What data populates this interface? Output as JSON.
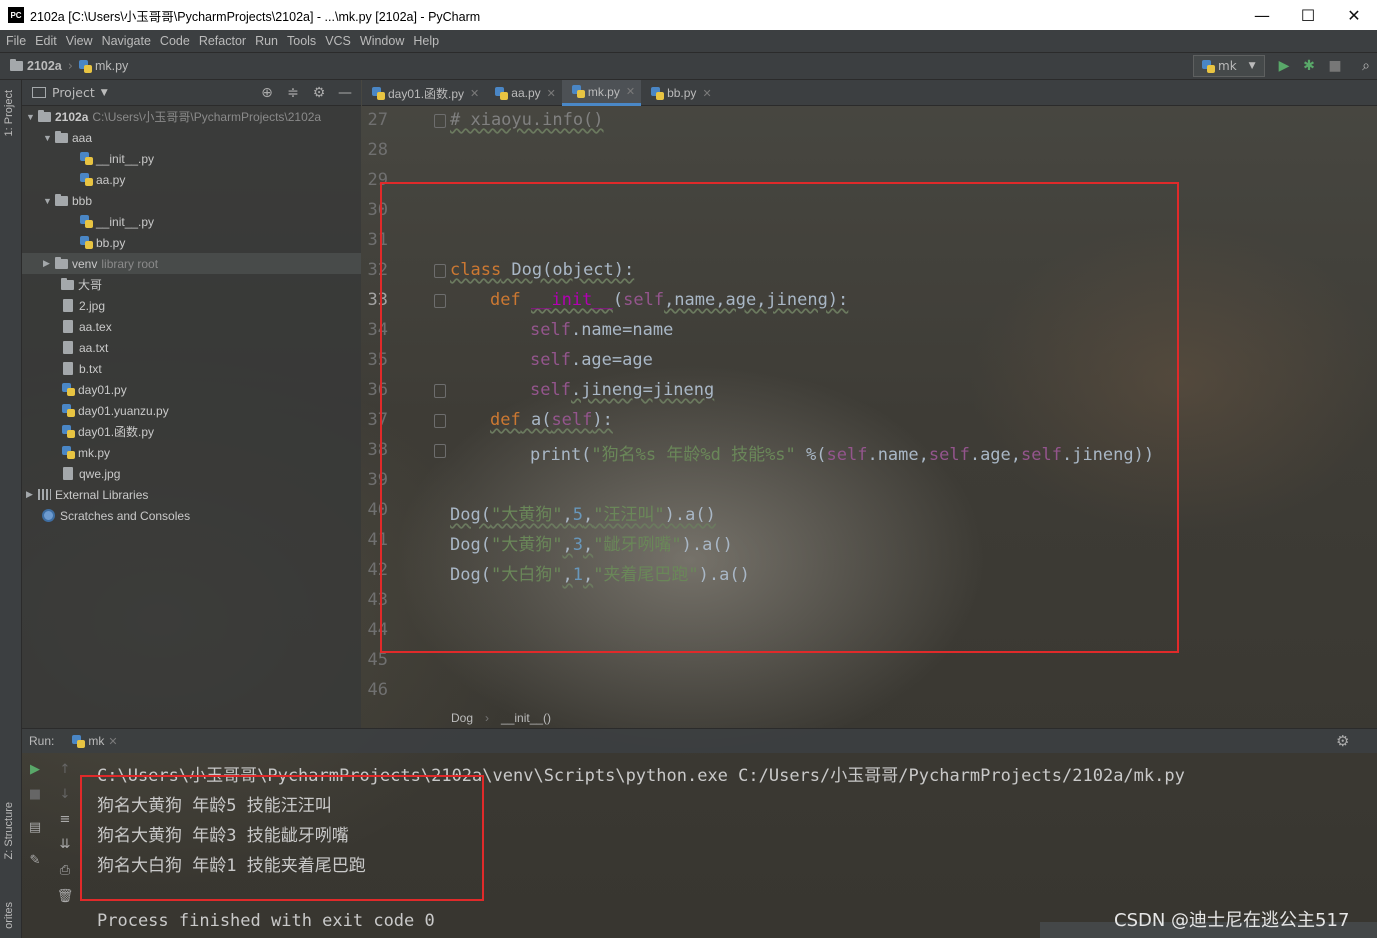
{
  "window": {
    "title": "2102a [C:\\Users\\小玉哥哥\\PycharmProjects\\2102a] - ...\\mk.py [2102a] - PyCharm",
    "app_icon_label": "PC",
    "minimize": "—",
    "maximize": "☐",
    "close": "✕"
  },
  "menu": [
    "File",
    "Edit",
    "View",
    "Navigate",
    "Code",
    "Refactor",
    "Run",
    "Tools",
    "VCS",
    "Window",
    "Help"
  ],
  "navbar": {
    "project": "2102a",
    "file": "mk.py",
    "run_config": "mk"
  },
  "left_stripe": {
    "project_tab": "1: Project",
    "structure_tab": "Z: Structure",
    "favorites_tab": "orites"
  },
  "project_panel": {
    "header": "Project",
    "tree": [
      {
        "label": "2102a",
        "path": "C:\\Users\\小玉哥哥\\PycharmProjects\\2102a"
      },
      {
        "label": "aaa"
      },
      {
        "label": "__init__.py"
      },
      {
        "label": "aa.py"
      },
      {
        "label": "bbb"
      },
      {
        "label": "__init__.py"
      },
      {
        "label": "bb.py"
      },
      {
        "label": "venv",
        "suffix": "library root"
      },
      {
        "label": "大哥"
      },
      {
        "label": "2.jpg"
      },
      {
        "label": "aa.tex"
      },
      {
        "label": "aa.txt"
      },
      {
        "label": "b.txt"
      },
      {
        "label": "day01.py"
      },
      {
        "label": "day01.yuanzu.py"
      },
      {
        "label": "day01.函数.py"
      },
      {
        "label": "mk.py"
      },
      {
        "label": "qwe.jpg"
      },
      {
        "label": "External Libraries"
      },
      {
        "label": "Scratches and Consoles"
      }
    ]
  },
  "editor_tabs": [
    {
      "label": "day01.函数.py",
      "active": false
    },
    {
      "label": "aa.py",
      "active": false
    },
    {
      "label": "mk.py",
      "active": true
    },
    {
      "label": "bb.py",
      "active": false
    }
  ],
  "editor": {
    "line_numbers": [
      "27",
      "28",
      "29",
      "30",
      "31",
      "32",
      "33",
      "34",
      "35",
      "36",
      "37",
      "38",
      "39",
      "40",
      "41",
      "42",
      "43",
      "44",
      "45",
      "46"
    ],
    "tokens": {
      "l27_comment": "# xiaoyu.info()",
      "l32_kw": "class",
      "l32_name": " Dog(object):",
      "l33_kw": "def",
      "l33_magic": "__init__",
      "l33_paren": "(",
      "l33_self": "self",
      "l33_rest": ",name,age,jineng):",
      "self": "self",
      "l34_rest": ".name=name",
      "l35_rest": ".age=age",
      "l36_rest": ".jineng=jineng",
      "l37_kw": "def",
      "l37_name": " a(",
      "l37_close": "):",
      "l38_print": "print(",
      "l38_str": "\"狗名%s 年龄%d 技能%s\"",
      "l38_pct": " %(",
      "l38_a": ".name,",
      "l38_b": ".age,",
      "l38_c": ".jineng))",
      "call_open": "Dog(",
      "call_close": ").a()",
      "comma": ",",
      "l40_s1": "\"大黄狗\"",
      "l40_n": "5",
      "l40_s2": "\"汪汪叫\"",
      "l41_s1": "\"大黄狗\"",
      "l41_n": "3",
      "l41_s2": "\"龇牙咧嘴\"",
      "l42_s1": "\"大白狗\"",
      "l42_n": "1",
      "l42_s2": "\"夹着尾巴跑\""
    }
  },
  "editor_breadcrumb": [
    "Dog",
    "__init__()"
  ],
  "run_panel": {
    "label": "Run:",
    "tab": "mk",
    "console": [
      "C:\\Users\\小玉哥哥\\PycharmProjects\\2102a\\venv\\Scripts\\python.exe C:/Users/小玉哥哥/PycharmProjects/2102a/mk.py",
      "狗名大黄狗 年龄5 技能汪汪叫",
      "狗名大黄狗 年龄3 技能龇牙咧嘴",
      "狗名大白狗 年龄1 技能夹着尾巴跑",
      "",
      "Process finished with exit code 0"
    ]
  },
  "watermark": "CSDN @迪士尼在逃公主517",
  "colors": {
    "keyword": "#cc7832",
    "self": "#94558d",
    "string": "#6a8759",
    "number": "#6897bb",
    "highlight_box": "#e02a2a",
    "active_tab_underline": "#4a88c7"
  }
}
